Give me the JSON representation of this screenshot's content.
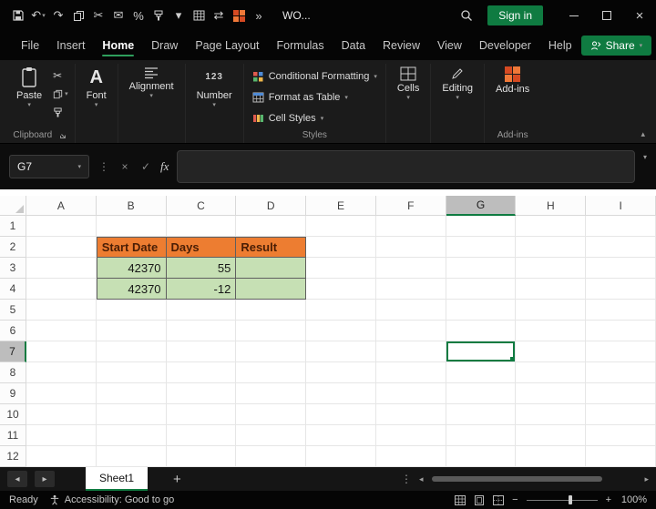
{
  "colors": {
    "accent_green": "#107C41",
    "table_header_fill": "#ED7D31",
    "table_data_fill": "#C6E0B4",
    "titlebar_bg": "#050505",
    "ribbon_bg": "#1B1B1B"
  },
  "icons": {
    "undo": "↶",
    "redo": "↷",
    "cut": "✂",
    "mail": "✉",
    "percent": "%",
    "swap": "⇄",
    "overflow": "»",
    "caret": "▾",
    "collapse": "▴",
    "expand": "▾",
    "ellipsis": "⋮",
    "cancel": "×",
    "check": "✓",
    "fx": "fx",
    "nav_left": "◂",
    "nav_right": "▸",
    "minus": "−",
    "plus": "+",
    "close": "×"
  },
  "title_bar": {
    "document_title": "WO...",
    "sign_in_label": "Sign in"
  },
  "menu": {
    "tabs": [
      "File",
      "Insert",
      "Home",
      "Draw",
      "Page Layout",
      "Formulas",
      "Data",
      "Review",
      "View",
      "Developer",
      "Help"
    ],
    "active_tab": "Home",
    "share_label": "Share"
  },
  "ribbon": {
    "paste_label": "Paste",
    "clipboard_group_label": "Clipboard",
    "font_label": "Font",
    "alignment_label": "Alignment",
    "number_label": "Number",
    "conditional_formatting_label": "Conditional Formatting",
    "format_as_table_label": "Format as Table",
    "cell_styles_label": "Cell Styles",
    "styles_group_label": "Styles",
    "cells_label": "Cells",
    "editing_label": "Editing",
    "addins_label": "Add-ins",
    "addins_group_label": "Add-ins"
  },
  "formula_bar": {
    "name_box": "G7"
  },
  "grid": {
    "columns": [
      "A",
      "B",
      "C",
      "D",
      "E",
      "F",
      "G",
      "H",
      "I"
    ],
    "rows": [
      "1",
      "2",
      "3",
      "4",
      "5",
      "6",
      "7",
      "8",
      "9",
      "10",
      "11",
      "12"
    ],
    "selected_column": "G",
    "selected_row": "7",
    "active_cell": "G7",
    "cells": {
      "B2": {
        "text": "Start Date",
        "style": "header"
      },
      "C2": {
        "text": "Days",
        "style": "header"
      },
      "D2": {
        "text": "Result",
        "style": "header"
      },
      "B3": {
        "text": "42370",
        "style": "number"
      },
      "C3": {
        "text": "55",
        "style": "number"
      },
      "D3": {
        "text": "",
        "style": "data"
      },
      "B4": {
        "text": "42370",
        "style": "number"
      },
      "C4": {
        "text": "-12",
        "style": "number"
      },
      "D4": {
        "text": "",
        "style": "data"
      }
    },
    "table": {
      "headers": [
        "Start Date",
        "Days",
        "Result"
      ],
      "rows": [
        [
          "42370",
          "55",
          ""
        ],
        [
          "42370",
          "-12",
          ""
        ]
      ]
    }
  },
  "sheet_tabs": {
    "tabs": [
      "Sheet1"
    ],
    "active": "Sheet1",
    "add_label": "+"
  },
  "status_bar": {
    "ready": "Ready",
    "accessibility": "Accessibility: Good to go",
    "zoom": "100%"
  }
}
